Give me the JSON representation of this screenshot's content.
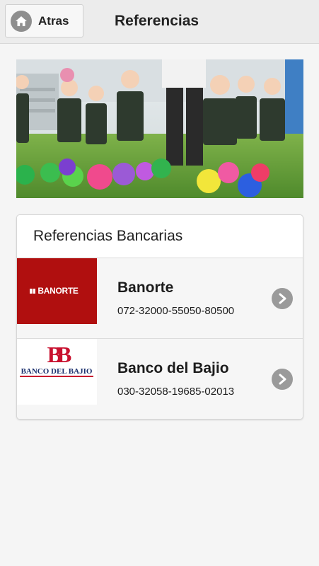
{
  "header": {
    "back_label": "Atras",
    "title": "Referencias",
    "back_icon": "home-icon"
  },
  "hero": {
    "icon": "photo-children-playing"
  },
  "references": {
    "title": "Referencias Bancarias",
    "banks": [
      {
        "name": "Banorte",
        "account": "072-32000-55050-80500",
        "logo_text": "BANORTE",
        "logo_color": "#b00f0f"
      },
      {
        "name": "Banco del Bajio",
        "account": "030-32058-19685-02013",
        "logo_text": "BANCO DEL BAJIO",
        "logo_mark": "BB",
        "logo_color": "#c8102e",
        "logo_text_color": "#1a2f6d"
      }
    ]
  },
  "colors": {
    "topbar": "#ececec",
    "background": "#f5f5f5",
    "chevron": "#9a9a9a"
  }
}
